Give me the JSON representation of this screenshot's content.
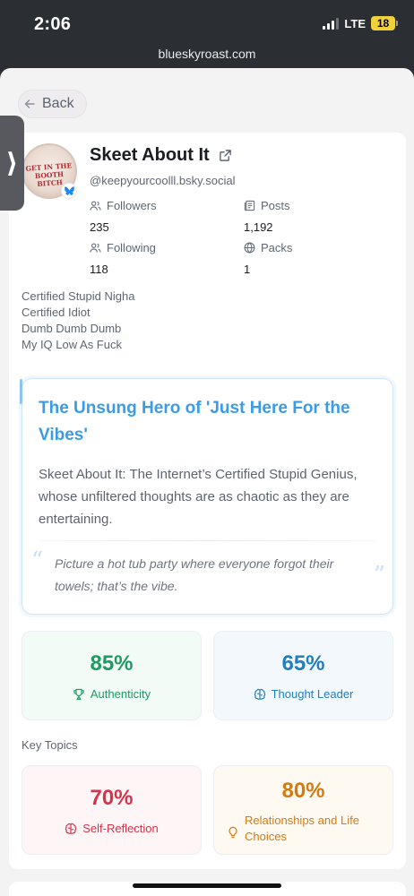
{
  "status": {
    "time": "2:06",
    "network": "LTE",
    "battery": "18"
  },
  "browser": {
    "url": "blueskyroast.com"
  },
  "nav": {
    "back_label": "Back"
  },
  "profile": {
    "name": "Skeet About It",
    "handle": "@keepyourcoolll.bsky.social",
    "avatar_text": "GET IN THE BOOTH BITCH",
    "stats": {
      "followers_label": "Followers",
      "followers_value": "235",
      "posts_label": "Posts",
      "posts_value": "1,192",
      "following_label": "Following",
      "following_value": "118",
      "packs_label": "Packs",
      "packs_value": "1"
    },
    "bio": [
      "Certified Stupid Nigha",
      "Certified Idiot",
      "Dumb Dumb Dumb",
      "My IQ Low As Fuck"
    ]
  },
  "roast": {
    "title": "The Unsung Hero of 'Just Here For the Vibes'",
    "summary": "Skeet About It: The Internet’s Certified Stupid Genius, whose unfiltered thoughts are as chaotic as they are entertaining.",
    "quote": "Picture a hot tub party where everyone forgot their towels; that’s the vibe."
  },
  "metrics": [
    {
      "value": "85%",
      "label": "Authenticity",
      "icon": "trophy-icon",
      "color": "#1f9a63",
      "bg": "#f3fbf7"
    },
    {
      "value": "65%",
      "label": "Thought Leader",
      "icon": "brain-icon",
      "color": "#1f7fbf",
      "bg": "#f3f8fd"
    }
  ],
  "key_topics_label": "Key Topics",
  "topics": [
    {
      "value": "70%",
      "label": "Self-Reflection",
      "icon": "brain-icon",
      "color": "#d7324a",
      "bg": "#fdf5f6"
    },
    {
      "value": "80%",
      "label": "Relationships and Life Choices",
      "icon": "lightbulb-icon",
      "color": "#d47b10",
      "bg": "#fefaf2"
    }
  ]
}
